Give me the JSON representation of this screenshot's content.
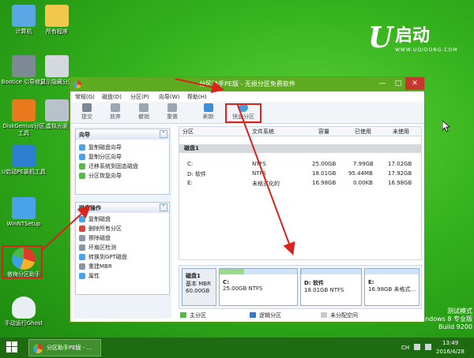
{
  "desktop": {
    "icons": [
      {
        "label": "计算机"
      },
      {
        "label": "所有程序"
      },
      {
        "label": "Bootice 引导修复"
      },
      {
        "label": "显示隐藏分区"
      },
      {
        "label": "DiskGenius分区工具"
      },
      {
        "label": "虚拟光驱"
      },
      {
        "label": "U启动PE装机工具"
      },
      {
        "label": "WinNTSetup"
      },
      {
        "label": "傲梅分区助手"
      },
      {
        "label": "手动运行Ghost"
      }
    ],
    "logo": {
      "mark": "U",
      "text": "启动",
      "website": "WWW.UQIDONG.COM"
    },
    "watermark": {
      "line1": "测试模式",
      "line2": "Windows 8 专业版",
      "line3": "Build 9200"
    }
  },
  "window": {
    "title": "分区助手PE版 - 无损分区免费软件",
    "menu": [
      "常规(G)",
      "磁盘(D)",
      "分区(P)",
      "向导(W)",
      "帮助(H)"
    ],
    "toolbar": [
      "提交",
      "放弃",
      "撤销",
      "重做",
      "刷新",
      "快速分区"
    ],
    "wizard_panel": {
      "title": "向导",
      "items": [
        "复制磁盘向导",
        "复制分区向导",
        "迁移系统到固态磁盘",
        "分区恢复向导"
      ]
    },
    "disk_ops_panel": {
      "title": "磁盘操作",
      "items": [
        "复制磁盘",
        "删除所有分区",
        "擦除磁盘",
        "坏扇区检测",
        "转换到GPT磁盘",
        "重建MBR",
        "属性"
      ]
    },
    "table": {
      "headers": [
        "分区",
        "文件系统",
        "容量",
        "已使用",
        "未使用"
      ],
      "disk_label": "磁盘1",
      "rows": [
        {
          "part": "C:",
          "fs": "NTFS",
          "cap": "25.00GB",
          "used": "7.99GB",
          "free": "17.02GB"
        },
        {
          "part": "D: 软件",
          "fs": "NTFS",
          "cap": "18.01GB",
          "used": "95.44MB",
          "free": "17.92GB"
        },
        {
          "part": "E:",
          "fs": "未格式化的",
          "cap": "16.98GB",
          "used": "0.00KB",
          "free": "16.98GB"
        }
      ]
    },
    "diskmap": {
      "disk": {
        "name": "磁盘1",
        "type": "基本 MBR",
        "size": "60.00GB"
      },
      "partitions": [
        {
          "name": "C:",
          "detail": "25.00GB NTFS",
          "usage": 0.32
        },
        {
          "name": "D: 软件",
          "detail": "18.01GB NTFS",
          "usage": 0.01
        },
        {
          "name": "E:",
          "detail": "16.98GB 未格式...",
          "usage": 0
        }
      ]
    },
    "legend": [
      "主分区",
      "逻辑分区",
      "未分配空间"
    ]
  },
  "taskbar": {
    "item": "分区助手PE版 - ...",
    "time": "13:49",
    "date": "2016/4/28",
    "ime": "CH"
  },
  "colors": {
    "accent": "#5cab20",
    "highlight": "#d9231b",
    "partition_bar": "#9bd98b"
  }
}
